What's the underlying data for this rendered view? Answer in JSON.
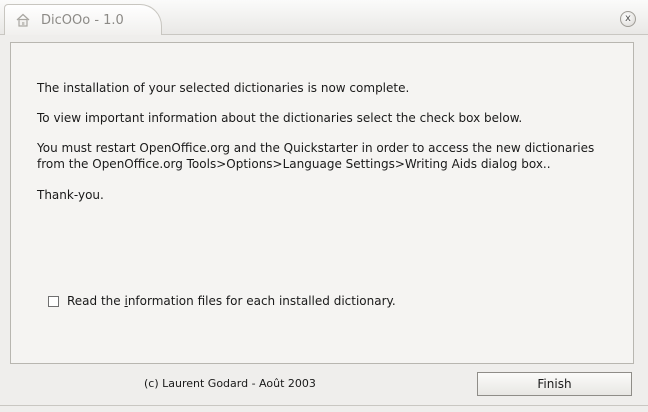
{
  "window": {
    "title": "DicOOo - 1.0",
    "close_glyph": "x"
  },
  "icons": {
    "app": "house-icon",
    "close": "close-icon",
    "checkbox": "checkbox-icon"
  },
  "content": {
    "line1": "The installation of your selected dictionaries is now complete.",
    "line2": "To view important information about the dictionaries select the check box below.",
    "line3a": "You must restart OpenOffice.org and the Quickstarter in order to access the new dictionaries",
    "line3b": "from the OpenOffice.org Tools>Options>Language Settings>Writing Aids dialog box..",
    "line4": "Thank-you."
  },
  "checkbox": {
    "checked": false,
    "label_before": "Read the ",
    "label_underlined": "i",
    "label_after": "nformation files for each installed dictionary."
  },
  "footer": {
    "credit": "(c) Laurent Godard - Août 2003",
    "finish_label": "Finish"
  }
}
